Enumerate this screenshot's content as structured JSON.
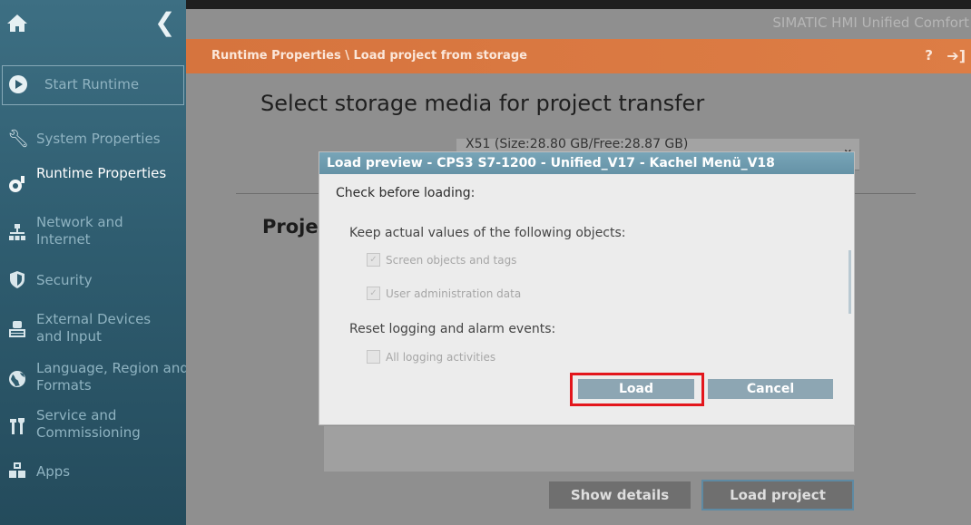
{
  "header": {
    "product": "SIMATIC HMI Unified Comfort",
    "breadcrumb": "Runtime Properties \\ Load project from storage",
    "help": "?",
    "exit_icon": "logout-icon"
  },
  "sidebar": {
    "home_icon": "home-icon",
    "back_icon": "chevron-left-icon",
    "items": [
      {
        "label": "Start Runtime",
        "icon": "play-circle-icon"
      },
      {
        "label": "System Properties",
        "icon": "wrench-icon"
      },
      {
        "label": "Runtime Properties",
        "icon": "runtime-gear-icon"
      },
      {
        "label": "Network and Internet",
        "icon": "network-icon"
      },
      {
        "label": "Security",
        "icon": "shield-icon"
      },
      {
        "label": "External Devices and Input",
        "icon": "keyboard-icon"
      },
      {
        "label": "Language, Region and Formats",
        "icon": "globe-icon"
      },
      {
        "label": "Service and Commissioning",
        "icon": "tools-icon"
      },
      {
        "label": "Apps",
        "icon": "apps-icon"
      }
    ]
  },
  "main": {
    "title": "Select storage media for project transfer",
    "storage_select": "X51 (Size:28.80 GB/Free:28.87 GB)",
    "section_partial": "Proje",
    "show_details": "Show details",
    "load_project": "Load project"
  },
  "dialog": {
    "title": "Load preview - CPS3 S7-1200 - Unified_V17 - Kachel Menü_V18",
    "subtitle": "Check before loading:",
    "keep_heading": "Keep actual values of the following objects:",
    "cb_screen": "Screen objects and tags",
    "cb_user": "User administration data",
    "reset_heading": "Reset logging and alarm events:",
    "cb_logging": "All logging activities",
    "load": "Load",
    "cancel": "Cancel"
  },
  "colors": {
    "sidebar": "#2f5d70",
    "orange_bar": "#d6743e",
    "highlight": "#e3161c",
    "dialog_button": "#8da6b3"
  }
}
